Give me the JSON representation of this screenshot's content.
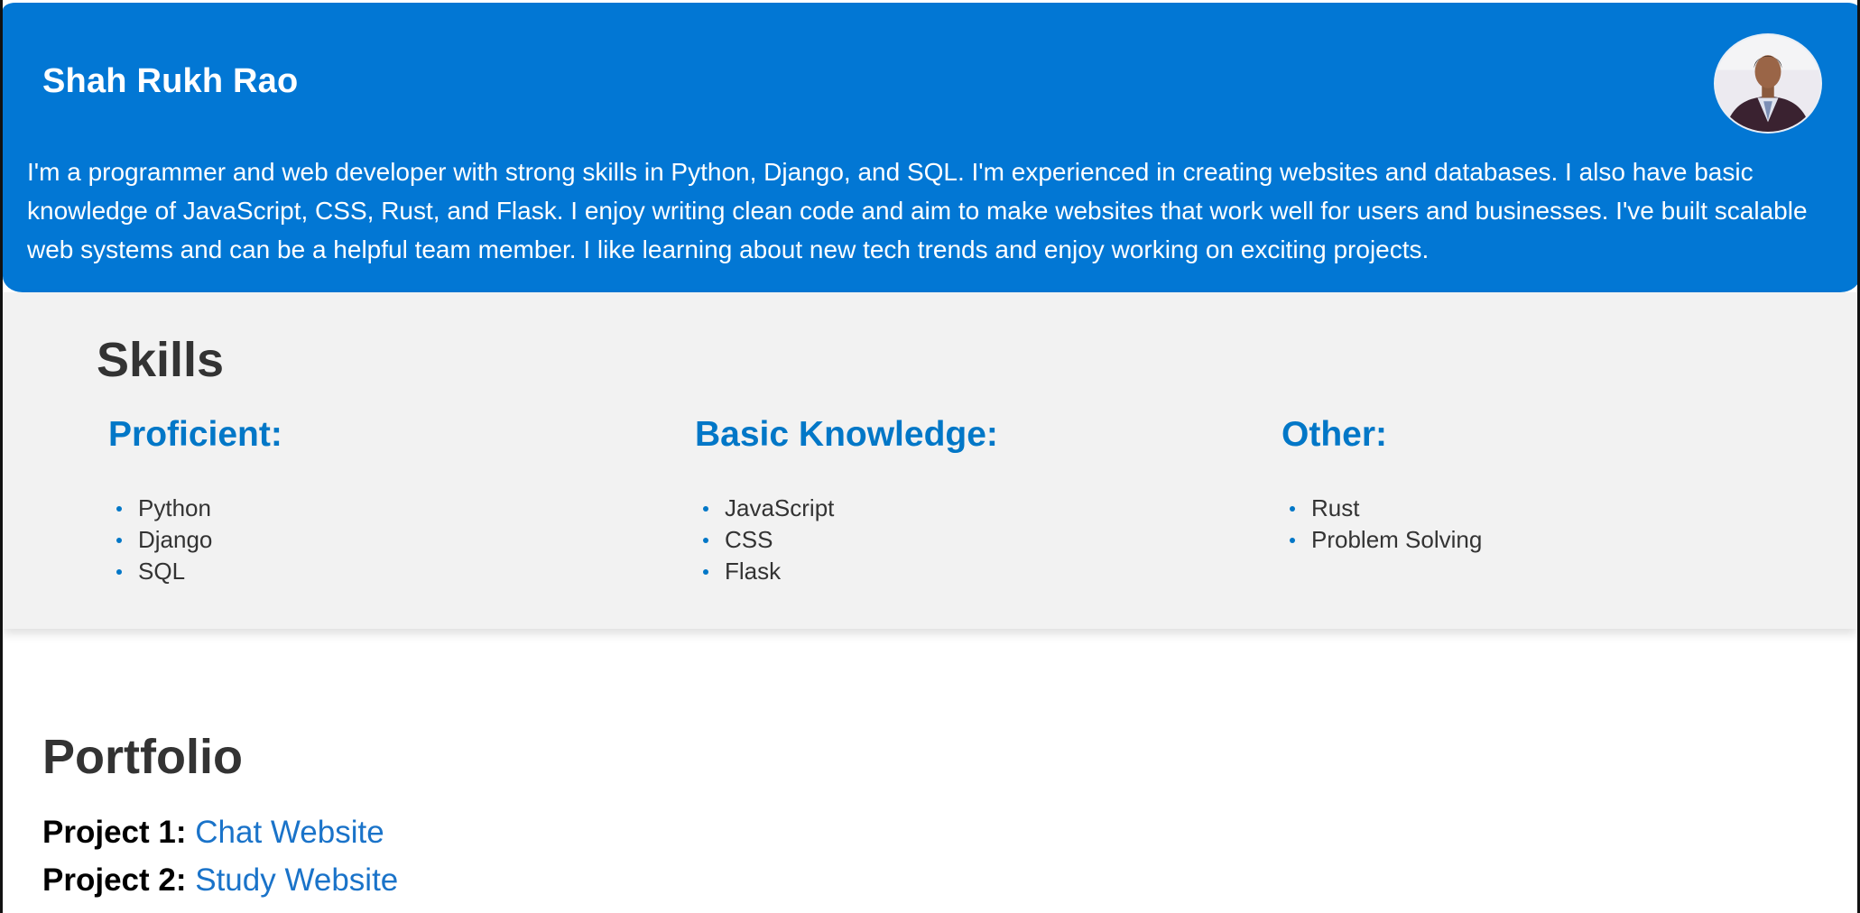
{
  "header": {
    "name": "Shah Rukh Rao",
    "bio": "I'm a programmer and web developer with strong skills in Python, Django, and SQL. I'm experienced in creating websites and databases. I also have basic knowledge of JavaScript, CSS, Rust, and Flask. I enjoy writing clean code and aim to make websites that work well for users and businesses. I've built scalable web systems and can be a helpful team member. I like learning about new tech trends and enjoy working on exciting projects.",
    "background_color": "#0277d4"
  },
  "skills": {
    "title": "Skills",
    "columns": [
      {
        "heading": "Proficient:",
        "items": [
          "Python",
          "Django",
          "SQL"
        ]
      },
      {
        "heading": "Basic Knowledge:",
        "items": [
          "JavaScript",
          "CSS",
          "Flask"
        ]
      },
      {
        "heading": "Other:",
        "items": [
          "Rust",
          "Problem Solving"
        ]
      }
    ],
    "accent_color": "#0277c7"
  },
  "portfolio": {
    "title": "Portfolio",
    "projects": [
      {
        "label": "Project 1:",
        "link_text": "Chat Website"
      },
      {
        "label": "Project 2:",
        "link_text": "Study Website"
      }
    ]
  }
}
